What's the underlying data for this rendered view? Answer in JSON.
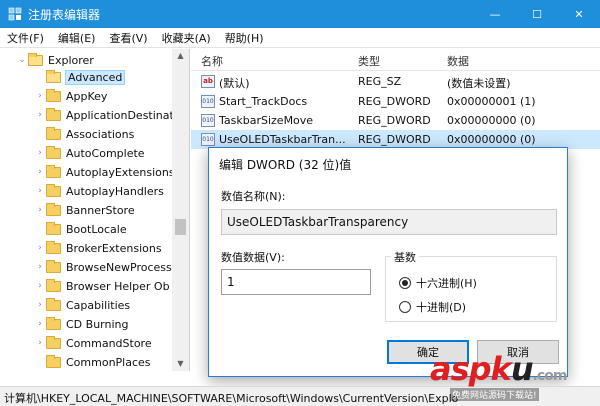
{
  "window": {
    "title": "注册表编辑器",
    "controls": {
      "minimize": "—",
      "maximize": "☐",
      "close": "✕"
    }
  },
  "menu": [
    "文件(F)",
    "编辑(E)",
    "查看(V)",
    "收藏夹(A)",
    "帮助(H)"
  ],
  "tree": {
    "parent": "Explorer",
    "items": [
      "Advanced",
      "AppKey",
      "ApplicationDestinat",
      "Associations",
      "AutoComplete",
      "AutoplayExtensions",
      "AutoplayHandlers",
      "BannerStore",
      "BootLocale",
      "BrokerExtensions",
      "BrowseNewProcess",
      "Browser Helper Ob",
      "Capabilities",
      "CD Burning",
      "CommandStore",
      "CommonPlaces"
    ],
    "selected": "Advanced"
  },
  "list": {
    "headers": {
      "name": "名称",
      "type": "类型",
      "data": "数据"
    },
    "rows": [
      {
        "icon": "ab",
        "name": "(默认)",
        "type": "REG_SZ",
        "data": "(数值未设置)"
      },
      {
        "icon": "dword",
        "name": "Start_TrackDocs",
        "type": "REG_DWORD",
        "data": "0x00000001 (1)"
      },
      {
        "icon": "dword",
        "name": "TaskbarSizeMove",
        "type": "REG_DWORD",
        "data": "0x00000000 (0)"
      },
      {
        "icon": "dword",
        "name": "UseOLEDTaskbarTran...",
        "type": "REG_DWORD",
        "data": "0x00000000 (0)"
      }
    ]
  },
  "dialog": {
    "title": "编辑 DWORD (32 位)值",
    "name_label": "数值名称(N):",
    "name_value": "UseOLEDTaskbarTransparency",
    "data_label": "数值数据(V):",
    "data_value": "1",
    "base_label": "基数",
    "hex_label": "十六进制(H)",
    "dec_label": "十进制(D)",
    "hex_selected": true,
    "ok_label": "确定",
    "cancel_label": "取消"
  },
  "statusbar": {
    "path": "计算机\\HKEY_LOCAL_MACHINE\\SOFTWARE\\Microsoft\\Windows\\CurrentVersion\\Explo"
  },
  "watermark": {
    "logo": "aspku",
    "logo_tld": ".com",
    "sub": "免费网站源码下载站!"
  },
  "colors": {
    "titlebar": "#1f8fdb",
    "selection": "#cce8ff",
    "dialog_border": "#2b7bd0",
    "default_button": "#0078d7",
    "wm_red": "#e02020",
    "wm_dark": "#222222"
  }
}
